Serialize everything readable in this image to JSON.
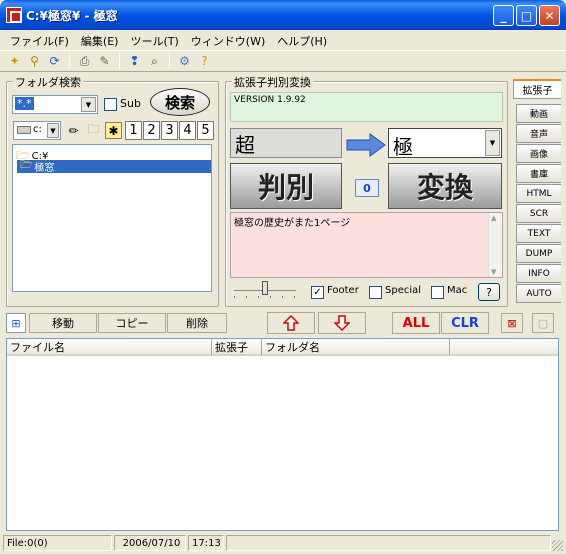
{
  "window": {
    "title": "C:¥極窓¥ - 極窓"
  },
  "titlebar_buttons": {
    "minimize": "_",
    "maximize": "□",
    "close": "✕"
  },
  "menu": [
    "ファイル(F)",
    "編集(E)",
    "ツール(T)",
    "ウィンドウ(W)",
    "ヘルプ(H)"
  ],
  "folder_search": {
    "label": "フォルダ検索",
    "pattern": "*.*",
    "sub_label": "Sub",
    "search_button": "検索",
    "drive": "c:",
    "numbers": [
      "1",
      "2",
      "3",
      "4",
      "5"
    ],
    "tree": [
      "C:¥",
      "極窓"
    ]
  },
  "ext_panel": {
    "label": "拡張子判別変換",
    "version": "VERSION 1.9.92",
    "from_text": "超",
    "to_value": "極",
    "judge_button": "判別",
    "count": "0",
    "convert_button": "変換",
    "memo": "極窓の歴史がまた1ページ",
    "footer_label": "Footer",
    "special_label": "Special",
    "mac_label": "Mac",
    "help_button": "?",
    "footer_checked": "✓"
  },
  "tabs": [
    "拡張子",
    "動画",
    "音声",
    "画像",
    "書庫",
    "HTML",
    "SCR",
    "TEXT",
    "DUMP",
    "INFO",
    "AUTO"
  ],
  "actions": {
    "move": "移動",
    "copy": "コピー",
    "delete": "削除",
    "all": "ALL",
    "clr": "CLR"
  },
  "file_list": {
    "columns": [
      "ファイル名",
      "拡張子",
      "フォルダ名"
    ]
  },
  "status": {
    "files": "File:0(0)",
    "date": "2006/07/10",
    "time": "17:13"
  },
  "colors": {
    "titlebar": "#0054e3",
    "version_bg": "#dff5df",
    "memo_bg": "#fde0e0",
    "accent_red": "#cc0000",
    "accent_blue": "#1a3fcf"
  }
}
